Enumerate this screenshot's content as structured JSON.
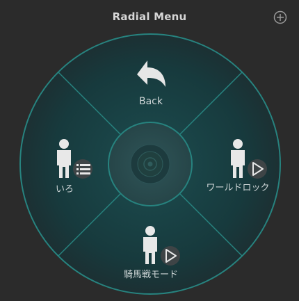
{
  "header": {
    "title": "Radial Menu",
    "add_icon": "plus-circle-icon"
  },
  "menu": {
    "center_icon": "target-icon",
    "items": [
      {
        "position": "top",
        "label": "Back",
        "icon": "back-arrow-icon"
      },
      {
        "position": "left",
        "label": "いろ",
        "icon": "person-icon",
        "badge_icon": "list-icon"
      },
      {
        "position": "right",
        "label": "ワールドロック",
        "icon": "person-icon",
        "badge_icon": "play-icon"
      },
      {
        "position": "bottom",
        "label": "騎馬戦モード",
        "icon": "person-icon",
        "badge_icon": "play-icon"
      }
    ]
  },
  "colors": {
    "background": "#2b2b2b",
    "ring_stroke": "#27837f",
    "ring_fill": "#163b3d",
    "text": "#cfd6d7"
  }
}
